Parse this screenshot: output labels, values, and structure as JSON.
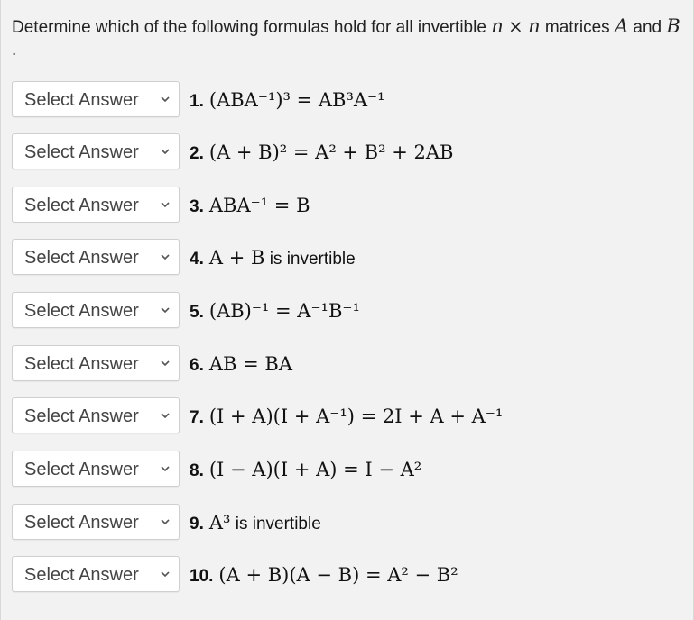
{
  "prompt": {
    "prefix": "Determine which of the following formulas hold for all invertible",
    "n": "n",
    "times": "×",
    "middle": "matrices",
    "A": "A",
    "and": "and",
    "B": "B",
    "dot": "."
  },
  "select_placeholder": "Select Answer",
  "questions": [
    {
      "number": "1.",
      "math": "(ABA⁻¹)³ = AB³A⁻¹",
      "text": ""
    },
    {
      "number": "2.",
      "math": "(A + B)² = A² + B² + 2AB",
      "text": ""
    },
    {
      "number": "3.",
      "math": "ABA⁻¹ = B",
      "text": ""
    },
    {
      "number": "4.",
      "math": "A + B",
      "text": "is invertible"
    },
    {
      "number": "5.",
      "math": "(AB)⁻¹ = A⁻¹B⁻¹",
      "text": ""
    },
    {
      "number": "6.",
      "math": "AB = BA",
      "text": ""
    },
    {
      "number": "7.",
      "math": "(I + A)(I + A⁻¹) = 2I + A + A⁻¹",
      "text": ""
    },
    {
      "number": "8.",
      "math": "(I − A)(I + A) = I − A²",
      "text": ""
    },
    {
      "number": "9.",
      "math": "A³",
      "text": "is invertible"
    },
    {
      "number": "10.",
      "math": "(A + B)(A − B) = A² − B²",
      "text": ""
    }
  ]
}
